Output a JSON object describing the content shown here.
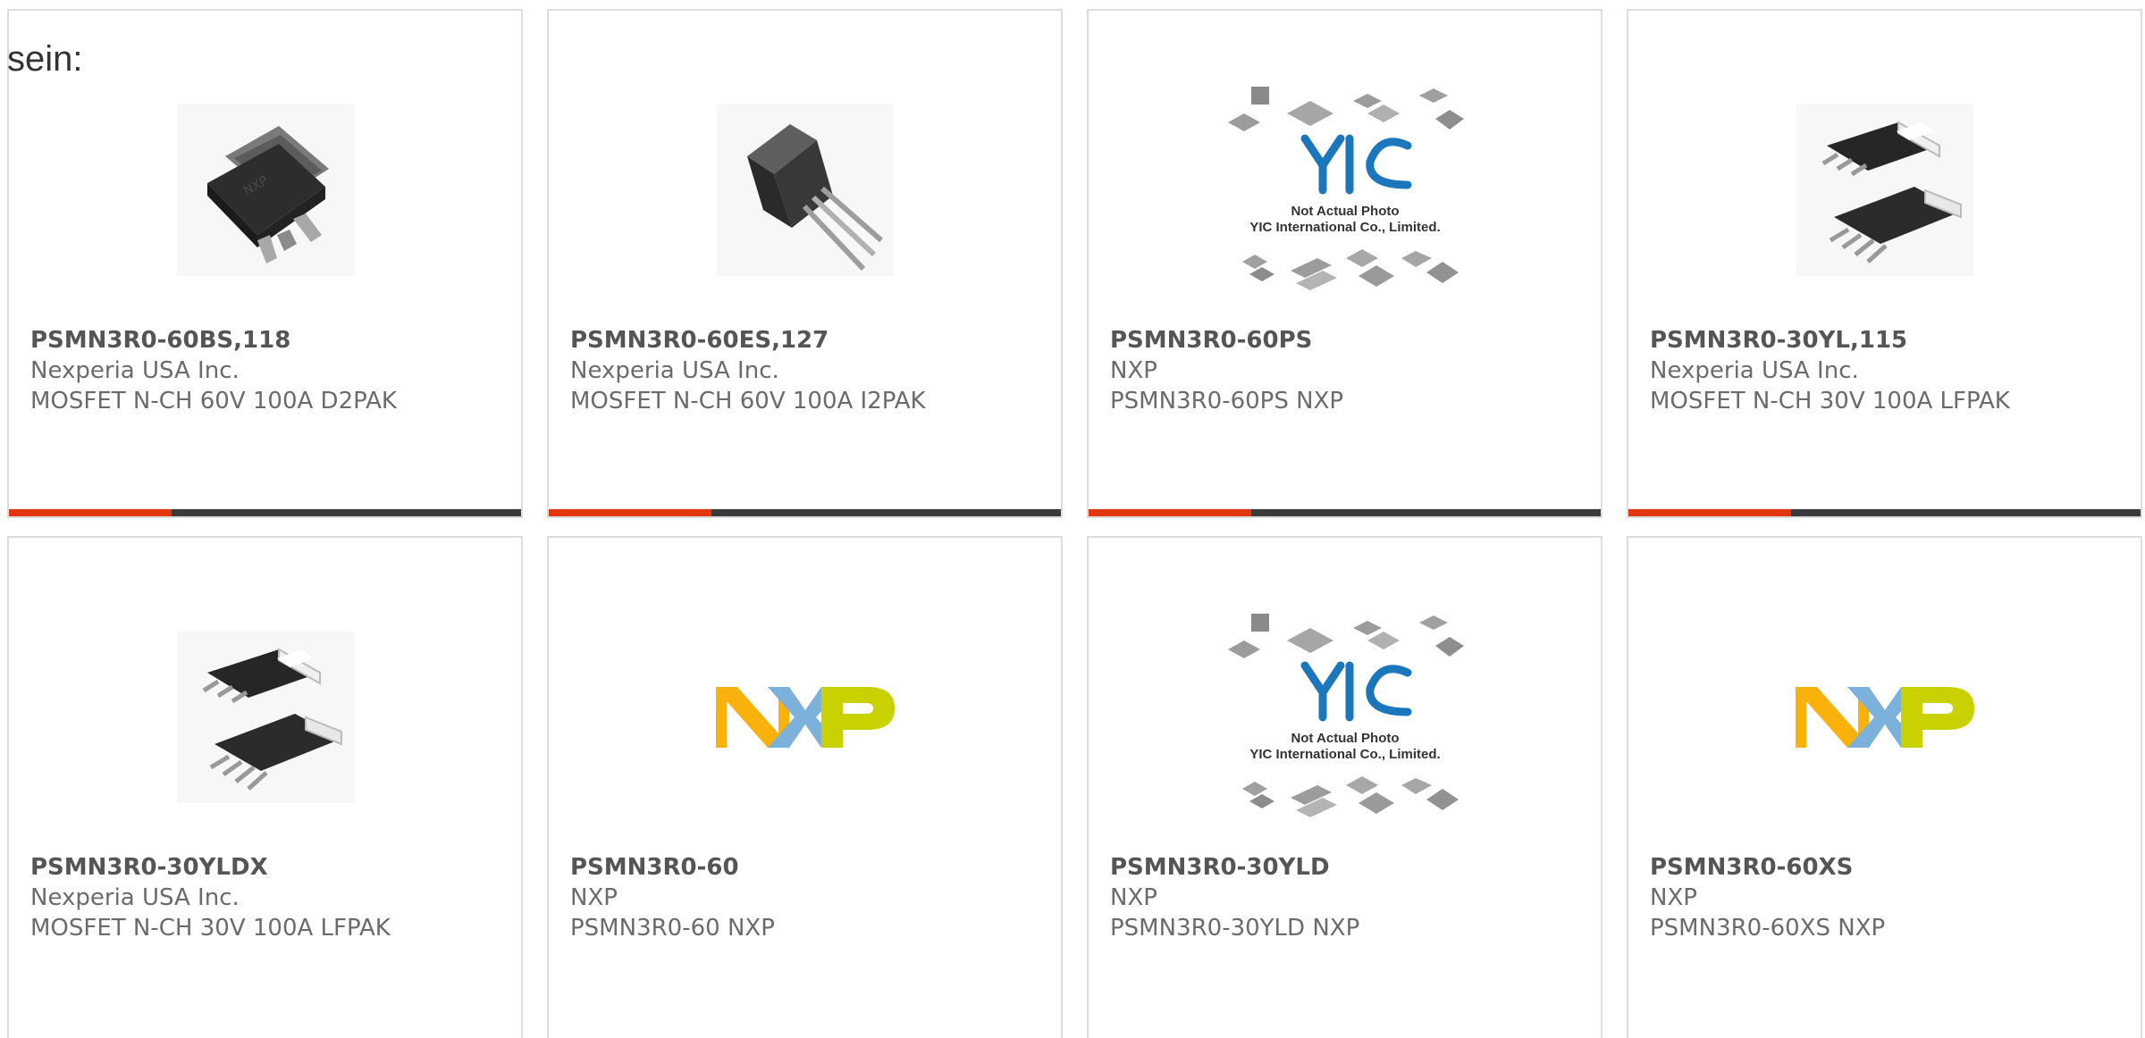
{
  "lead_text": "sein:",
  "colors": {
    "accent_bar": "#e2360f",
    "dark_bar": "#3a3a3a",
    "card_border": "#dddddd",
    "nxp_yellow": "#f9b20b",
    "nxp_blue": "#7bb1db",
    "nxp_green": "#c9d200",
    "yic_blue": "#1b76bc"
  },
  "products": [
    {
      "part_number": "PSMN3R0-60BS,118",
      "manufacturer": "Nexperia USA Inc.",
      "description": "MOSFET N-CH 60V 100A D2PAK",
      "image": "d2pak-package-icon"
    },
    {
      "part_number": "PSMN3R0-60ES,127",
      "manufacturer": "Nexperia USA Inc.",
      "description": "MOSFET N-CH 60V 100A I2PAK",
      "image": "i2pak-package-icon"
    },
    {
      "part_number": "PSMN3R0-60PS",
      "manufacturer": "NXP",
      "description": "PSMN3R0-60PS NXP",
      "image": "yic-placeholder-icon",
      "image_caption_line1": "Not Actual Photo",
      "image_caption_line2": "YIC International Co., Limited.",
      "image_logo": "YIC"
    },
    {
      "part_number": "PSMN3R0-30YL,115",
      "manufacturer": "Nexperia USA Inc.",
      "description": "MOSFET N-CH 30V 100A LFPAK",
      "image": "lfpak-package-icon"
    },
    {
      "part_number": "PSMN3R0-30YLDX",
      "manufacturer": "Nexperia USA Inc.",
      "description": "MOSFET N-CH 30V 100A LFPAK",
      "image": "lfpak-package-icon"
    },
    {
      "part_number": "PSMN3R0-60",
      "manufacturer": "NXP",
      "description": "PSMN3R0-60 NXP",
      "image": "nxp-logo-icon"
    },
    {
      "part_number": "PSMN3R0-30YLD",
      "manufacturer": "NXP",
      "description": "PSMN3R0-30YLD NXP",
      "image": "yic-placeholder-icon",
      "image_caption_line1": "Not Actual Photo",
      "image_caption_line2": "YIC International Co., Limited.",
      "image_logo": "YIC"
    },
    {
      "part_number": "PSMN3R0-60XS",
      "manufacturer": "NXP",
      "description": "PSMN3R0-60XS NXP",
      "image": "nxp-logo-icon"
    }
  ]
}
